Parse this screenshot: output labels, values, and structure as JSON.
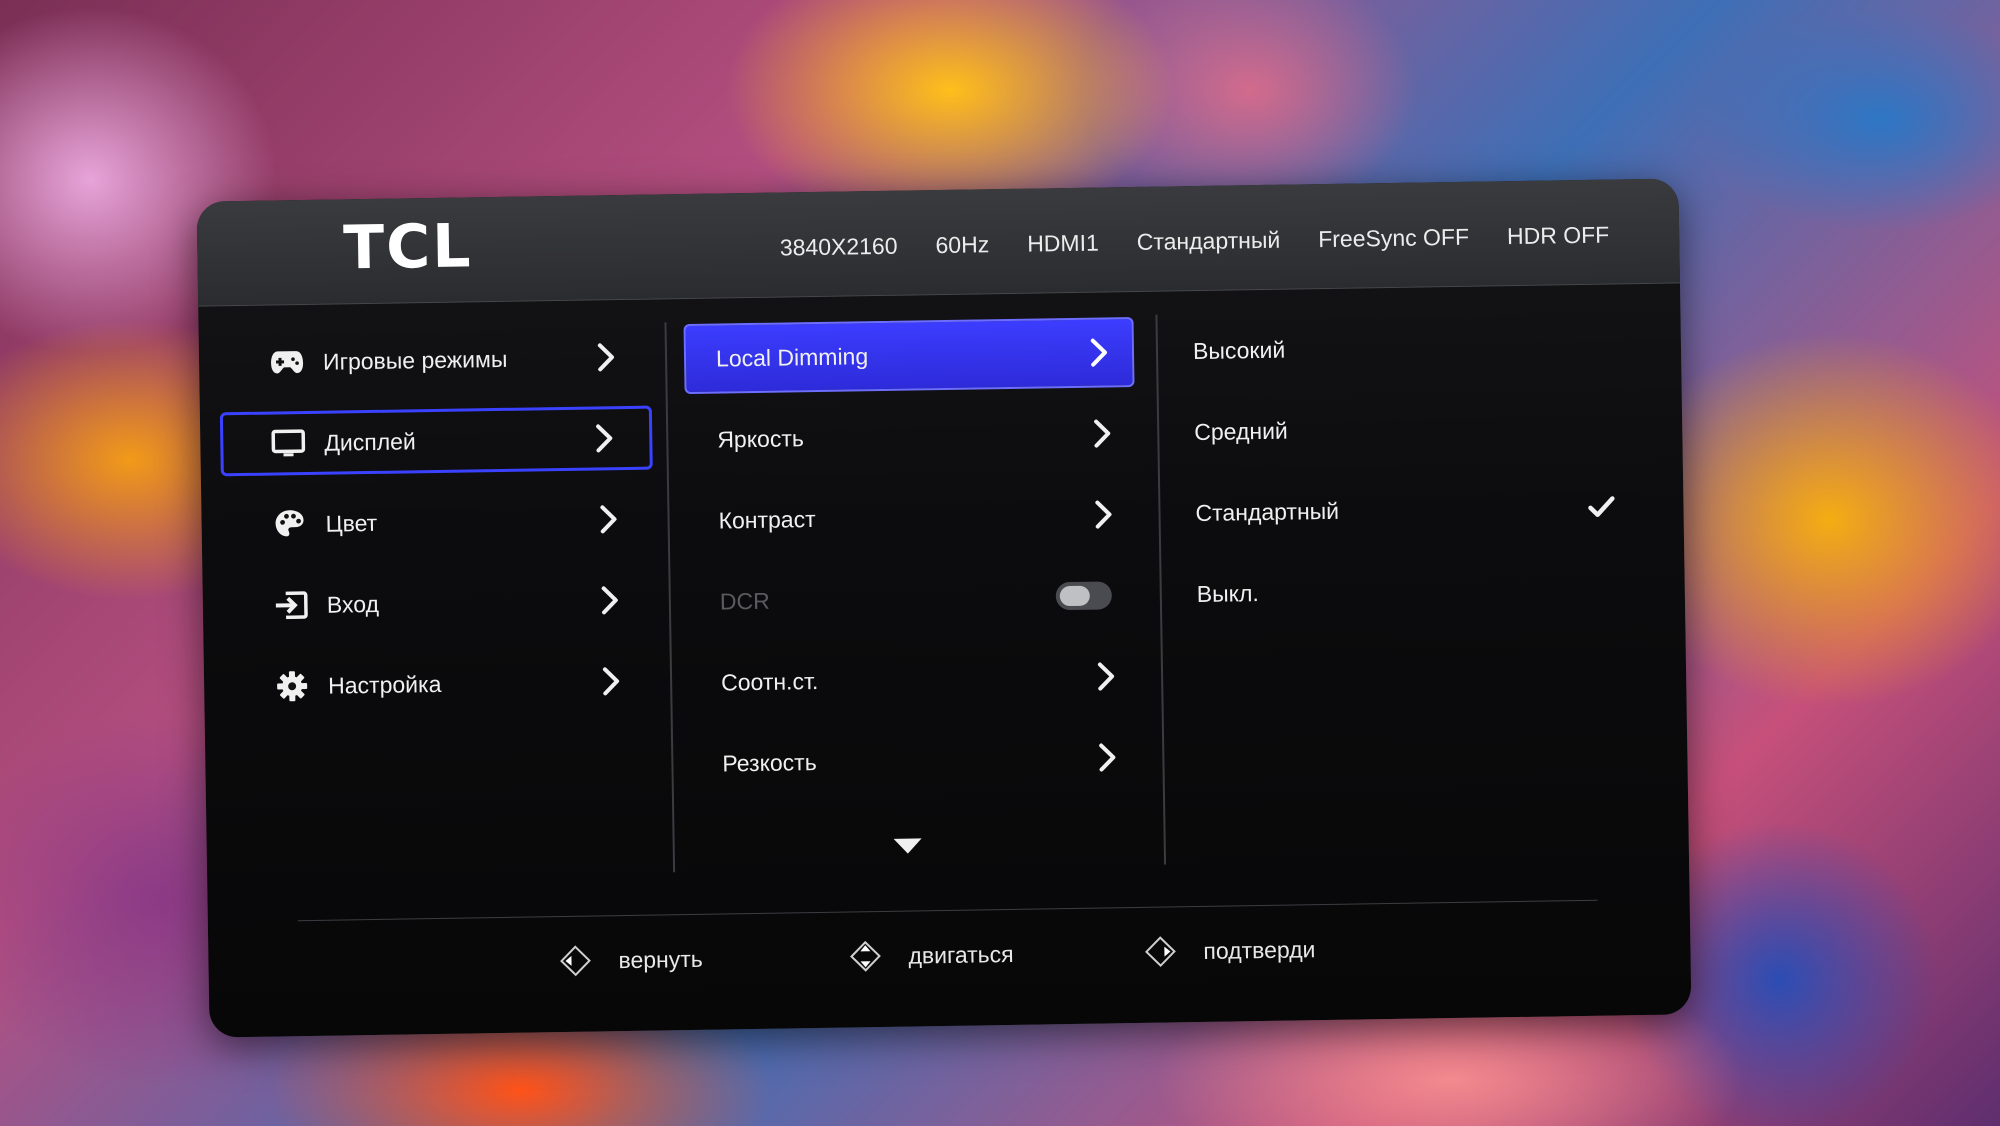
{
  "header": {
    "brand": "TCL",
    "status": [
      "3840X2160",
      "60Hz",
      "HDMI1",
      "Стандартный",
      "FreeSync OFF",
      "HDR OFF"
    ]
  },
  "main_menu": [
    {
      "label": "Игровые режимы",
      "icon": "gamepad-icon"
    },
    {
      "label": "Дисплей",
      "icon": "monitor-icon"
    },
    {
      "label": "Цвет",
      "icon": "palette-icon"
    },
    {
      "label": "Вход",
      "icon": "input-icon"
    },
    {
      "label": "Настройка",
      "icon": "gear-icon"
    }
  ],
  "selected_main": "Дисплей",
  "sub_menu": [
    {
      "label": "Local Dimming",
      "control": "chevron"
    },
    {
      "label": "Яркость",
      "control": "chevron"
    },
    {
      "label": "Контраст",
      "control": "chevron"
    },
    {
      "label": "DCR",
      "control": "toggle",
      "disabled": true,
      "toggle_state": "off"
    },
    {
      "label": "Соотн.ст.",
      "control": "chevron"
    },
    {
      "label": "Резкость",
      "control": "chevron"
    }
  ],
  "active_sub": "Local Dimming",
  "options": [
    {
      "label": "Высокий",
      "checked": false
    },
    {
      "label": "Средний",
      "checked": false
    },
    {
      "label": "Стандартный",
      "checked": true
    },
    {
      "label": "Выкл.",
      "checked": false
    }
  ],
  "footer": {
    "back": "вернуть",
    "move": "двигаться",
    "confirm": "подтверди"
  },
  "colors": {
    "accent": "#3b3dff",
    "panel": "#0c0c0e",
    "header": "#2f3033"
  }
}
